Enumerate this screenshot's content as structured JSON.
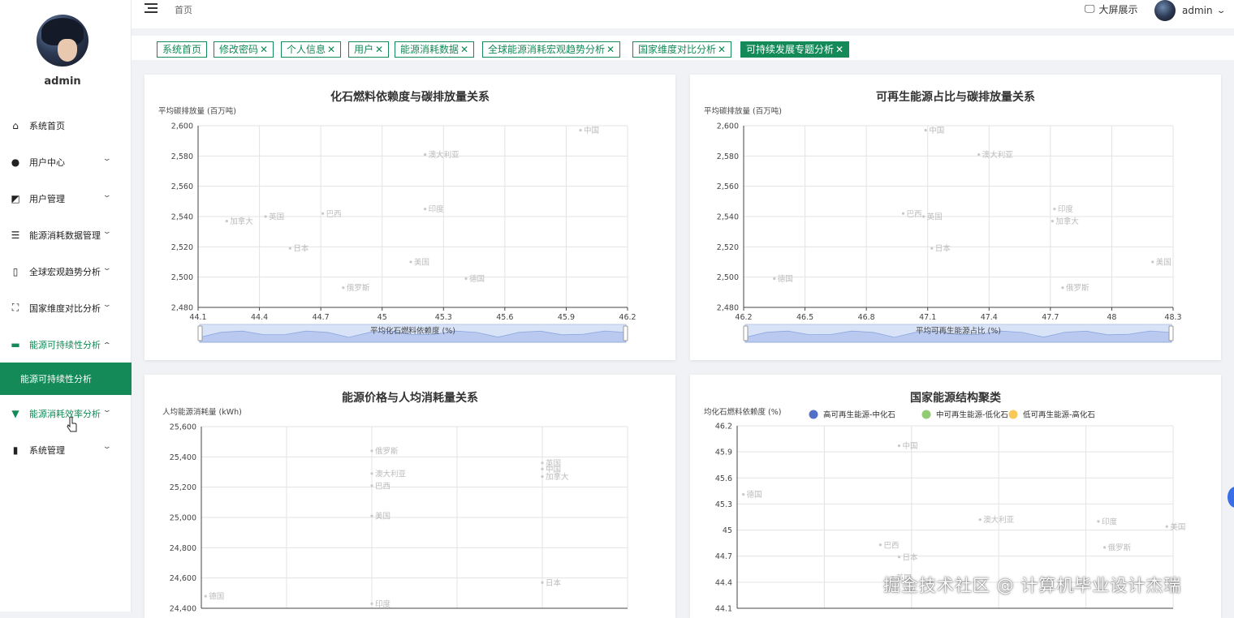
{
  "user": {
    "name": "admin"
  },
  "sidebar": {
    "items": [
      {
        "label": "系统首页",
        "icon": "home-icon",
        "arrow": false
      },
      {
        "label": "用户中心",
        "icon": "user-icon",
        "arrow": true
      },
      {
        "label": "用户管理",
        "icon": "chart-area-icon",
        "arrow": true
      },
      {
        "label": "能源消耗数据管理",
        "icon": "list-icon",
        "arrow": true
      },
      {
        "label": "全球宏观趋势分析",
        "icon": "phone-icon",
        "arrow": true
      },
      {
        "label": "国家维度对比分析",
        "icon": "expand-icon",
        "arrow": true
      },
      {
        "label": "能源可持续性分析",
        "icon": "monitor-icon",
        "arrow": true,
        "expanded": true
      },
      {
        "label": "能源消耗效率分析",
        "icon": "pin-icon",
        "arrow": true
      },
      {
        "label": "系统管理",
        "icon": "bar-chart-icon",
        "arrow": true
      }
    ],
    "sub_item": "能源可持续性分析"
  },
  "header": {
    "breadcrumb": "首页",
    "big_screen": "大屏展示",
    "user": "admin"
  },
  "tabs": [
    {
      "label": "系统首页",
      "closable": false
    },
    {
      "label": "修改密码",
      "closable": true
    },
    {
      "label": "个人信息",
      "closable": true
    },
    {
      "label": "用户",
      "closable": true
    },
    {
      "label": "能源消耗数据",
      "closable": true
    },
    {
      "label": "全球能源消耗宏观趋势分析",
      "closable": true
    },
    {
      "label": "国家维度对比分析",
      "closable": true
    },
    {
      "label": "可持续发展专题分析",
      "closable": true,
      "active": true
    }
  ],
  "watermark": "掘金技术社区 @ 计算机毕业设计杰瑞",
  "chart_data": [
    {
      "type": "scatter",
      "title": "化石燃料依赖度与碳排放量关系",
      "ylabel": "平均碳排放量 (百万吨)",
      "xlabel": "平均化石燃料依赖度 (%)",
      "xlim": [
        44.1,
        46.2
      ],
      "ylim": [
        2480,
        2600
      ],
      "xticks": [
        "44.1",
        "44.4",
        "44.7",
        "45",
        "45.3",
        "45.6",
        "45.9",
        "46.2"
      ],
      "yticks": [
        "2,480",
        "2,500",
        "2,520",
        "2,540",
        "2,560",
        "2,580",
        "2,600"
      ],
      "points": [
        {
          "name": "中国",
          "x": 45.97,
          "y": 2597
        },
        {
          "name": "澳大利亚",
          "x": 45.21,
          "y": 2581
        },
        {
          "name": "印度",
          "x": 45.21,
          "y": 2545
        },
        {
          "name": "巴西",
          "x": 44.71,
          "y": 2542
        },
        {
          "name": "英国",
          "x": 44.43,
          "y": 2540
        },
        {
          "name": "加拿大",
          "x": 44.24,
          "y": 2537
        },
        {
          "name": "日本",
          "x": 44.55,
          "y": 2519
        },
        {
          "name": "美国",
          "x": 45.14,
          "y": 2510
        },
        {
          "name": "德国",
          "x": 45.41,
          "y": 2499
        },
        {
          "name": "俄罗斯",
          "x": 44.81,
          "y": 2493
        }
      ],
      "zoom": true
    },
    {
      "type": "scatter",
      "title": "可再生能源占比与碳排放量关系",
      "ylabel": "平均碳排放量 (百万吨)",
      "xlabel": "平均可再生能源占比 (%)",
      "xlim": [
        46.2,
        48.3
      ],
      "ylim": [
        2480,
        2600
      ],
      "xticks": [
        "46.2",
        "46.5",
        "46.8",
        "47.1",
        "47.4",
        "47.7",
        "48",
        "48.3"
      ],
      "yticks": [
        "2,480",
        "2,500",
        "2,520",
        "2,540",
        "2,560",
        "2,580",
        "2,600"
      ],
      "points": [
        {
          "name": "中国",
          "x": 47.09,
          "y": 2597
        },
        {
          "name": "澳大利亚",
          "x": 47.35,
          "y": 2581
        },
        {
          "name": "印度",
          "x": 47.72,
          "y": 2545
        },
        {
          "name": "巴西",
          "x": 46.98,
          "y": 2542
        },
        {
          "name": "英国",
          "x": 47.08,
          "y": 2540
        },
        {
          "name": "加拿大",
          "x": 47.71,
          "y": 2537
        },
        {
          "name": "日本",
          "x": 47.12,
          "y": 2519
        },
        {
          "name": "美国",
          "x": 48.2,
          "y": 2510
        },
        {
          "name": "德国",
          "x": 46.35,
          "y": 2499
        },
        {
          "name": "俄罗斯",
          "x": 47.76,
          "y": 2493
        }
      ],
      "zoom": true
    },
    {
      "type": "scatter",
      "title": "能源价格与人均消耗量关系",
      "ylabel": "人均能源消耗量 (kWh)",
      "xlabel": "",
      "xlim": [
        0,
        5
      ],
      "ylim": [
        24400,
        25600
      ],
      "xticks": [],
      "yticks": [
        "24,400",
        "24,600",
        "24,800",
        "25,000",
        "25,200",
        "25,400",
        "25,600"
      ],
      "points": [
        {
          "name": "俄罗斯",
          "x": 2,
          "y": 25440
        },
        {
          "name": "澳大利亚",
          "x": 2,
          "y": 25290
        },
        {
          "name": "巴西",
          "x": 2,
          "y": 25210
        },
        {
          "name": "英国",
          "x": 4,
          "y": 25360
        },
        {
          "name": "中国",
          "x": 4,
          "y": 25320
        },
        {
          "name": "加拿大",
          "x": 4,
          "y": 25270
        },
        {
          "name": "美国",
          "x": 2,
          "y": 25010
        },
        {
          "name": "德国",
          "x": 0.05,
          "y": 24480
        },
        {
          "name": "日本",
          "x": 4,
          "y": 24570
        },
        {
          "name": "印度",
          "x": 2,
          "y": 24430
        }
      ],
      "zoom": false
    },
    {
      "type": "scatter",
      "title": "国家能源结构聚类",
      "ylabel": "均化石燃料依赖度 (%)",
      "xlabel": "",
      "xlim": [
        0,
        7
      ],
      "ylim": [
        44.1,
        46.2
      ],
      "xticks": [],
      "yticks": [
        "44.1",
        "44.4",
        "44.7",
        "45",
        "45.3",
        "45.6",
        "45.9",
        "46.2"
      ],
      "legend": [
        {
          "name": "高可再生能源-中化石",
          "color": "#5470c6"
        },
        {
          "name": "中可再生能源-低化石",
          "color": "#91cc75"
        },
        {
          "name": "低可再生能源-高化石",
          "color": "#fac858"
        }
      ],
      "points": [
        {
          "name": "中国",
          "x": 2.6,
          "y": 45.97
        },
        {
          "name": "德国",
          "x": 0.1,
          "y": 45.41
        },
        {
          "name": "澳大利亚",
          "x": 3.9,
          "y": 45.12
        },
        {
          "name": "印度",
          "x": 5.8,
          "y": 45.1
        },
        {
          "name": "美国",
          "x": 6.9,
          "y": 45.04
        },
        {
          "name": "巴西",
          "x": 2.3,
          "y": 44.83
        },
        {
          "name": "俄罗斯",
          "x": 5.9,
          "y": 44.8
        },
        {
          "name": "日本",
          "x": 2.6,
          "y": 44.69
        },
        {
          "name": "英国",
          "x": 2.5,
          "y": 44.45
        }
      ],
      "zoom": false
    }
  ]
}
